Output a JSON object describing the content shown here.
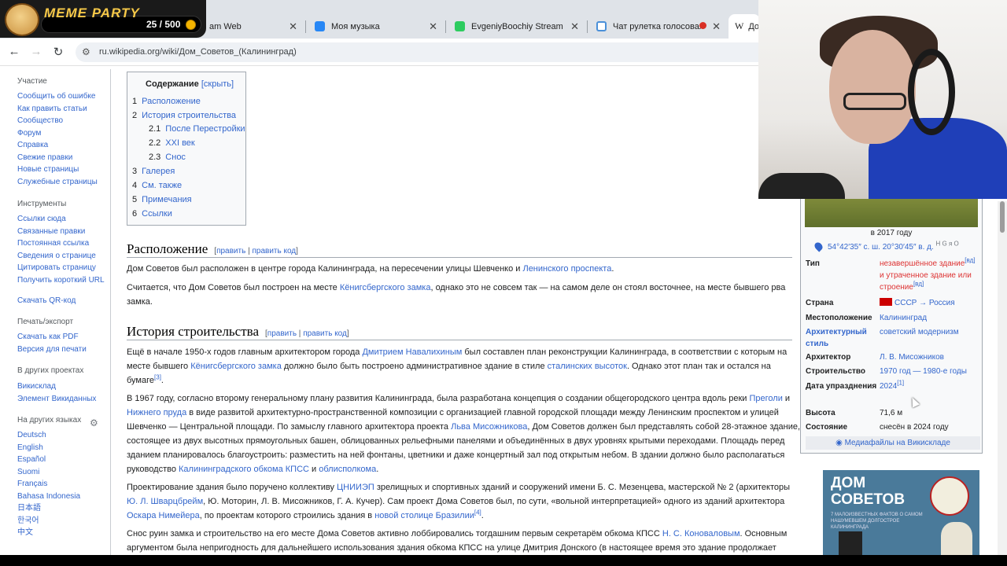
{
  "overlay": {
    "title": "MEME PARTY",
    "counter": "25 / 500"
  },
  "tabs": [
    {
      "label": "am Web"
    },
    {
      "label": "Моя музыка"
    },
    {
      "label": "EvgeniyBoochiy Stream - Wa"
    },
    {
      "label": "Чат рулетка голосовая"
    },
    {
      "label": "До"
    }
  ],
  "url": "ru.wikipedia.org/wiki/Дом_Советов_(Калининград)",
  "sidebar": {
    "sections": [
      {
        "head": "Участие",
        "items": [
          "Сообщить об ошибке",
          "Как править статьи",
          "Сообщество",
          "Форум",
          "Справка",
          "Свежие правки",
          "Новые страницы",
          "Служебные страницы"
        ]
      },
      {
        "head": "Инструменты",
        "items": [
          "Ссылки сюда",
          "Связанные правки",
          "Постоянная ссылка",
          "Сведения о странице",
          "Цитировать страницу",
          "Получить короткий URL",
          "Скачать QR-код"
        ]
      },
      {
        "head": "Печать/экспорт",
        "items": [
          "Скачать как PDF",
          "Версия для печати"
        ]
      },
      {
        "head": "В других проектах",
        "items": [
          "Викисклад",
          "Элемент Викиданных"
        ]
      },
      {
        "head": "На других языках",
        "items": [
          "Deutsch",
          "English",
          "Español",
          "Suomi",
          "Français",
          "Bahasa Indonesia",
          "日本語",
          "한국어",
          "中文"
        ]
      }
    ]
  },
  "toc": {
    "title": "Содержание",
    "hide": "[скрыть]",
    "items": [
      {
        "num": "1",
        "label": "Расположение"
      },
      {
        "num": "2",
        "label": "История строительства"
      },
      {
        "num": "2.1",
        "label": "После Перестройки"
      },
      {
        "num": "2.2",
        "label": "XXI век"
      },
      {
        "num": "2.3",
        "label": "Снос"
      },
      {
        "num": "3",
        "label": "Галерея"
      },
      {
        "num": "4",
        "label": "См. также"
      },
      {
        "num": "5",
        "label": "Примечания"
      },
      {
        "num": "6",
        "label": "Ссылки"
      }
    ]
  },
  "edit": {
    "open": "[",
    "edit": "править",
    "bar": " | ",
    "editcode": "править код",
    "close": "]"
  },
  "sections": {
    "location": "Расположение",
    "history": "История строительства"
  },
  "paras": {
    "p1a": "Дом Советов был расположен в центре города Калининграда, на пересечении улицы Шевченко и ",
    "p1link": "Ленинского проспекта",
    "p1b": ".",
    "p2a": "Считается, что Дом Советов был построен на месте ",
    "p2link": "Кёнигсбергского замка",
    "p2b": ", однако это не совсем так — на самом деле он стоял восточнее, на месте бывшего рва замка.",
    "p3a": "Ещё в начале 1950-х годов главным архитектором города ",
    "p3l1": "Дмитрием Навалихиным",
    "p3b": " был составлен план реконструкции Калининграда, в соответствии с которым на месте бывшего ",
    "p3l2": "Кёнигсбергского замка",
    "p3c": " должно было быть построено административное здание в стиле ",
    "p3l3": "сталинских высоток",
    "p3d": ". Однако этот план так и остался на бумаге",
    "p3sup": "[3]",
    "p3e": ".",
    "p4a": "В 1967 году, согласно второму генеральному плану развития Калининграда, была разработана концепция о создании общегородского центра вдоль реки ",
    "p4l1": "Преголи",
    "p4b": " и ",
    "p4l2": "Нижнего пруда",
    "p4c": " в виде развитой архитектурно-пространственной композиции с организацией главной городской площади между Ленинским проспектом и улицей Шевченко — Центральной площади. По замыслу главного архитектора проекта ",
    "p4l3": "Льва Мисожникова",
    "p4d": ", Дом Советов должен был представлять собой 28-этажное здание, состоящее из двух высотных прямоугольных башен, облицованных рельефными панелями и объединённых в двух уровнях крытыми переходами. Площадь перед зданием планировалось благоустроить: разместить на ней фонтаны, цветники и даже концертный зал под открытым небом. В здании должно было располагаться руководство ",
    "p4l4": "Калининградского обкома КПСС",
    "p4e": " и ",
    "p4l5": "облисполкома",
    "p4f": ".",
    "p5a": "Проектирование здания было поручено коллективу ",
    "p5l1": "ЦНИИЭП",
    "p5b": " зрелищных и спортивных зданий и сооружений имени Б. С. Мезенцева, мастерской № 2 (архитекторы ",
    "p5l2": "Ю. Л. Шварцбрейм",
    "p5c": ", Ю. Моторин, Л. В. Мисожников, Г. А. Кучер). Сам проект Дома Советов был, по сути, «вольной интерпретацией» одного из зданий архитектора ",
    "p5l3": "Оскара Нимейера",
    "p5d": ", по проектам которого строились здания в ",
    "p5l4": "новой столице Бразилии",
    "p5sup": "[4]",
    "p5e": ".",
    "p6a": "Снос руин замка и строительство на его месте Дома Советов активно лоббировались тогдашним первым секретарём обкома КПСС ",
    "p6l1": "Н. С. Коноваловым",
    "p6b": ". Основным аргументом была непригодность для дальнейшего использования здания обкома КПСС на улице Дмитрия Донского (в настоящее время это здание продолжает"
  },
  "infobox": {
    "caption": "в 2017 году",
    "coords": "54°42′35″ с. ш. 20°30′45″ в. д.",
    "coords_extra": "H G я O",
    "rows": [
      {
        "label": "Тип",
        "val": "незавершённое здание",
        "sup": "[вд]",
        "val2": " и утраченное здание или строение",
        "sup2": "[вд]"
      },
      {
        "label": "Страна",
        "val": "СССР → Россия"
      },
      {
        "label": "Местоположение",
        "val": "Калининград"
      },
      {
        "label": "Архитектурный стиль",
        "val": "советский модернизм"
      },
      {
        "label": "Архитектор",
        "val": "Л. В. Мисожников"
      },
      {
        "label": "Строительство",
        "val": "1970 год — 1980-е годы"
      },
      {
        "label": "Дата упразднения",
        "val": "2024",
        "sup": "[1]"
      },
      {
        "label": "Высота",
        "val": "71,6 м"
      },
      {
        "label": "Состояние",
        "val": "снесён в 2024 году"
      }
    ],
    "commons": "Медиафайлы на Викискладе"
  },
  "book": {
    "title": "ДОМ СОВЕТОВ",
    "sub": "7 МАЛОИЗВЕСТНЫХ ФАКТОВ О САМОМ НАШУМЕВШЕМ ДОЛГОСТРОЕ КАЛИНИНГРАДА"
  }
}
